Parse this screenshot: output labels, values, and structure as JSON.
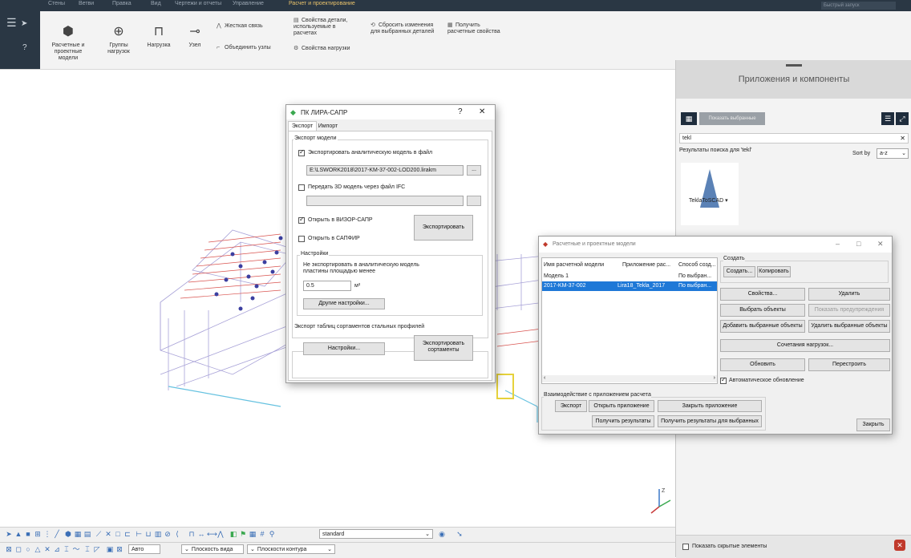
{
  "ribbon": {
    "tabs": [
      "Стены",
      "Ветви",
      "Правка",
      "Вид",
      "Чертежи и отчеты",
      "Управление",
      "Расчет и проектирование"
    ],
    "active_tab": "Расчет и проектирование",
    "search_placeholder": "Быстрый запуск",
    "buttons": {
      "models": "Расчетные и проектные модели",
      "load_groups": "Группы нагрузок",
      "load": "Нагрузка",
      "node": "Узел",
      "rigid_link": "Жесткая связь",
      "merge_nodes": "Объединить узлы",
      "part_props": "Свойства детали, используемые в расчетах",
      "load_props": "Свойства нагрузки",
      "reset_changes": "Сбросить изменения для выбранных деталей",
      "get_props": "Получить расчетные свойства"
    }
  },
  "lira_dialog": {
    "title": "ПК ЛИРА-САПР",
    "help": "?",
    "close": "✕",
    "tabs": [
      "Экспорт",
      "Импорт"
    ],
    "group_export_model": "Экспорт модели",
    "chk_export_analytic": "Экспортировать аналитическую модель в файл",
    "file_path": "E:\\LSWORK2018\\2017-KM-37-002-LOD200.lirakm",
    "browse": "...",
    "chk_ifc": "Передать 3D модель через файл IFC",
    "chk_vizor": "Открыть в ВИЗОР-САПР",
    "chk_sapfir": "Открыть в САПФИР",
    "export_btn": "Экспортировать",
    "group_settings": "Настройки",
    "settings_note": "Не экспортировать в аналитическую модель пластины площадью менее",
    "area_value": "0.5",
    "area_unit": "м²",
    "other_settings": "Другие настройки...",
    "group_profiles": "Экспорт таблиц сортаментов стальных профилей",
    "settings_btn": "Настройки...",
    "export_profiles_btn": "Экспортировать сортаменты"
  },
  "models_dialog": {
    "title": "Расчетные и проектные модели",
    "columns": [
      "Имя расчетной модели",
      "Приложение рас...",
      "Способ созд..."
    ],
    "rows": [
      {
        "name": "Модель 1",
        "app": "",
        "method": "По выбран..."
      },
      {
        "name": "2017-KM-37-002",
        "app": "Lira18_Tekla_2017",
        "method": "По выбран..."
      }
    ],
    "create_group": "Создать",
    "create_btn": "Создать...",
    "copy_btn": "Копировать",
    "properties_btn": "Свойства...",
    "delete_btn": "Удалить",
    "select_objects_btn": "Выбрать объекты",
    "show_warnings_btn": "Показать предупреждения",
    "add_selected_btn": "Добавить выбранные объекты",
    "remove_selected_btn": "Удалить выбранные объекты",
    "load_combos_btn": "Сочетания нагрузок...",
    "refresh_btn": "Обновить",
    "rebuild_btn": "Перестроить",
    "auto_update": "Автоматическое обновление",
    "interaction_label": "Взаимодействие с приложением расчета",
    "export_btn": "Экспорт",
    "open_app_btn": "Открыть приложение",
    "close_app_btn": "Закрыть приложение",
    "get_results_btn": "Получить результаты",
    "get_results_selected_btn": "Получить результаты для выбранных",
    "close_btn": "Закрыть"
  },
  "apps_panel": {
    "title": "Приложения и компоненты",
    "show_selected": "Показать выбранные",
    "search_value": "tekl",
    "results_label": "Результаты поиска для 'tekl'",
    "sort_label": "Sort by",
    "sort_value": "a-z",
    "item_name": "TeklaToSCAD",
    "show_hidden": "Показать скрытые элементы"
  },
  "bottom_bar": {
    "standard": "standard",
    "auto": "Авто",
    "view_plane": "Плоскость вида",
    "contour_plane": "Плоскости контура"
  },
  "colors": {
    "selection": "#1e78d7",
    "dark_header": "#2a3744",
    "model_purple": "#6a5fb3",
    "model_red": "#d9534f"
  }
}
